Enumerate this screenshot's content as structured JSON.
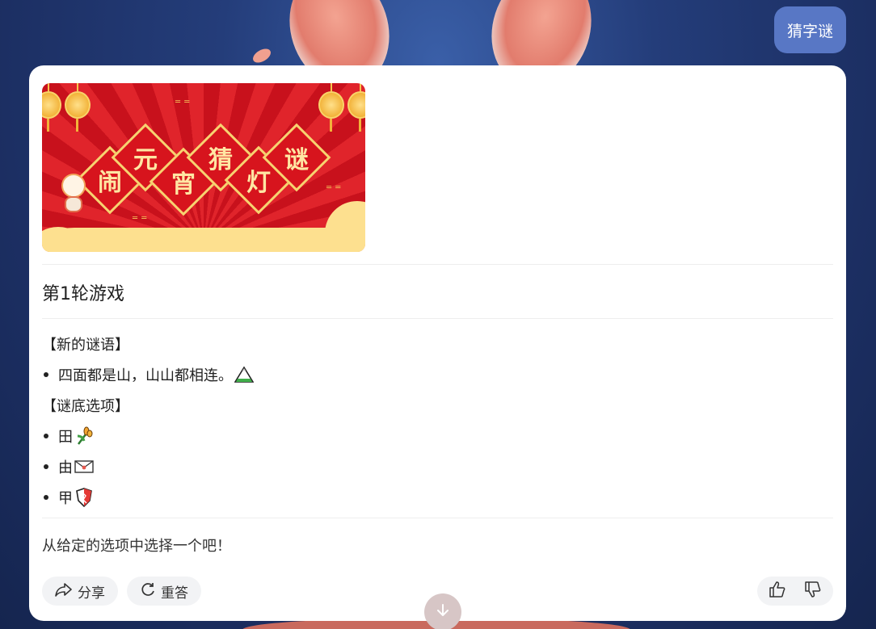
{
  "user_message": "猜字谜",
  "banner": {
    "chars": [
      "闹",
      "元",
      "宵",
      "猜",
      "灯",
      "谜"
    ]
  },
  "round_title": "第1轮游戏",
  "riddle": {
    "new_label": "【新的谜语】",
    "text": "四面都是山，山山都相连。",
    "text_icon": "mountain-icon",
    "options_label": "【谜底选项】",
    "options": [
      {
        "label": "田",
        "icon": "rice-plant-icon"
      },
      {
        "label": "由",
        "icon": "envelope-icon"
      },
      {
        "label": "甲",
        "icon": "shield-icon"
      }
    ]
  },
  "prompt_text": "从给定的选项中选择一个吧！",
  "actions": {
    "share_label": "分享",
    "regenerate_label": "重答"
  },
  "colors": {
    "user_bubble": "#5877c5",
    "banner_red": "#d7141d",
    "banner_gold": "#f7d270"
  }
}
